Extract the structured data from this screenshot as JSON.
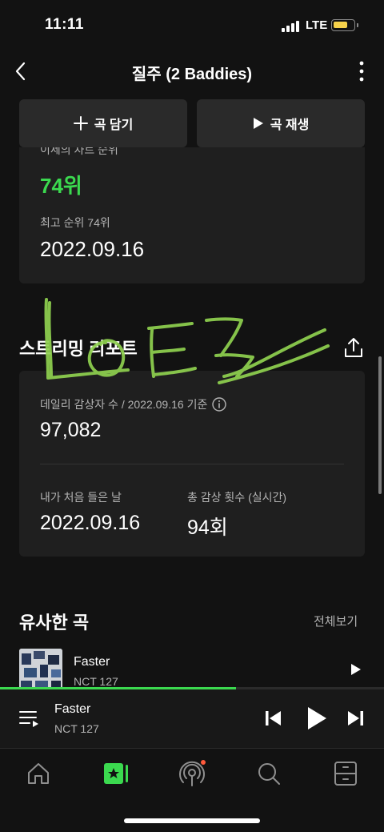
{
  "status_bar": {
    "time": "11:11",
    "network": "LTE"
  },
  "header": {
    "title": "질주 (2 Baddies)",
    "back_icon": "chevron-left-icon",
    "more_icon": "more-vertical-icon"
  },
  "actions": {
    "add_label": "곡 담기",
    "play_label": "곡 재생"
  },
  "chart_rank": {
    "prev_label": "이제의 차트 순위",
    "current_rank": "74위",
    "best_label": "최고 순위 74위",
    "best_date": "2022.09.16"
  },
  "streaming_report": {
    "title": "스트리밍 리포트",
    "daily_label": "데일리 감상자 수 / 2022.09.16 기준",
    "daily_value": "97,082",
    "first_label": "내가 처음 들은 날",
    "first_date": "2022.09.16",
    "total_label": "총 감상 횟수 (실시간)",
    "total_value": "94회"
  },
  "similar": {
    "title": "유사한 곡",
    "view_all": "전체보기",
    "songs": [
      {
        "title": "Faster",
        "artist": "NCT 127"
      }
    ]
  },
  "now_playing": {
    "title": "Faster",
    "artist": "NCT 127",
    "progress": 0.615
  },
  "nav": {
    "items": [
      "home-icon",
      "library-icon",
      "podcast-icon",
      "search-icon",
      "storage-icon"
    ],
    "active_index": 1
  },
  "colors": {
    "accent": "#3bd94f",
    "background": "#121212",
    "card": "#1f1f1f",
    "graffiti": "#8fd14f"
  }
}
